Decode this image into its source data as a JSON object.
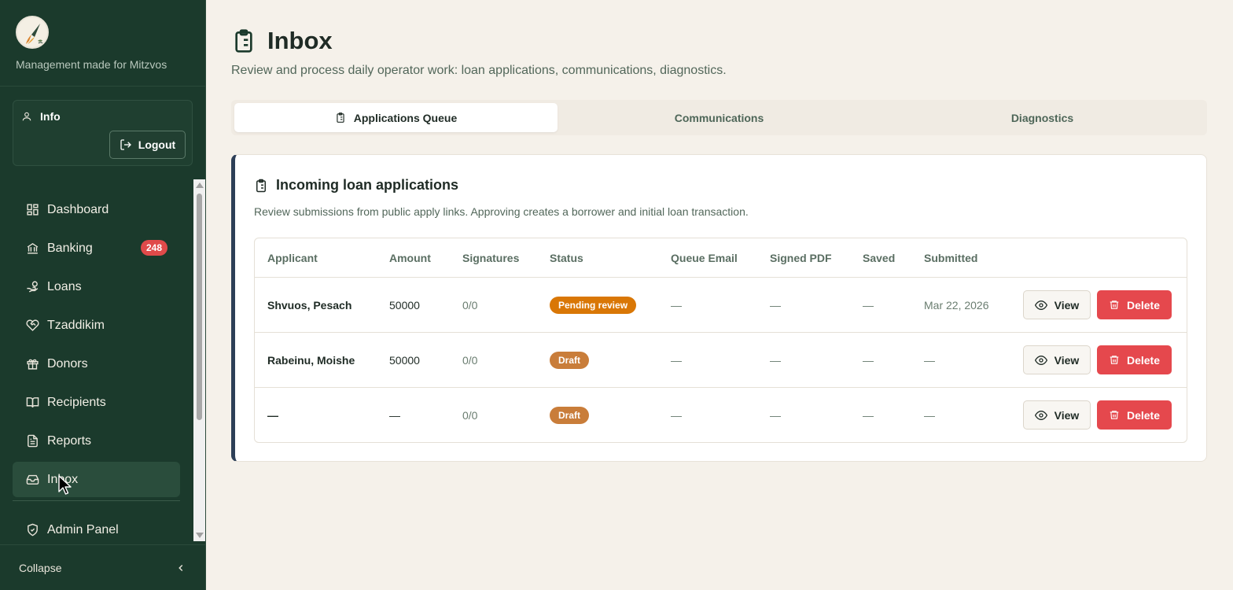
{
  "sidebar": {
    "tagline": "Management made for Mitzvos",
    "user_label": "Info",
    "logout_label": "Logout",
    "items": [
      {
        "label": "Dashboard",
        "icon": "dashboard-icon"
      },
      {
        "label": "Banking",
        "icon": "bank-icon",
        "badge": "248"
      },
      {
        "label": "Loans",
        "icon": "hand-coins-icon"
      },
      {
        "label": "Tzaddikim",
        "icon": "heart-handshake-icon"
      },
      {
        "label": "Donors",
        "icon": "gift-icon"
      },
      {
        "label": "Recipients",
        "icon": "book-open-icon"
      },
      {
        "label": "Reports",
        "icon": "file-text-icon"
      },
      {
        "label": "Inbox",
        "icon": "inbox-icon",
        "active": true
      },
      {
        "label": "Admin Panel",
        "icon": "shield-check-icon"
      }
    ],
    "collapse_label": "Collapse"
  },
  "header": {
    "title": "Inbox",
    "subtitle": "Review and process daily operator work: loan applications, communications, diagnostics."
  },
  "tabs": [
    {
      "label": "Applications Queue",
      "active": true
    },
    {
      "label": "Communications"
    },
    {
      "label": "Diagnostics"
    }
  ],
  "card": {
    "title": "Incoming loan applications",
    "subtitle": "Review submissions from public apply links. Approving creates a borrower and initial loan transaction."
  },
  "table": {
    "columns": [
      "Applicant",
      "Amount",
      "Signatures",
      "Status",
      "Queue Email",
      "Signed PDF",
      "Saved",
      "Submitted"
    ],
    "rows": [
      {
        "applicant": "Shvuos, Pesach",
        "amount": "50000",
        "signatures": "0/0",
        "status": "Pending review",
        "queue_email": "—",
        "signed_pdf": "—",
        "saved": "—",
        "submitted": "Mar 22, 2026"
      },
      {
        "applicant": "Rabeinu, Moishe",
        "amount": "50000",
        "signatures": "0/0",
        "status": "Draft",
        "queue_email": "—",
        "signed_pdf": "—",
        "saved": "—",
        "submitted": "—"
      },
      {
        "applicant": "—",
        "amount": "—",
        "signatures": "0/0",
        "status": "Draft",
        "queue_email": "—",
        "signed_pdf": "—",
        "saved": "—",
        "submitted": "—"
      }
    ],
    "view_label": "View",
    "delete_label": "Delete"
  },
  "colors": {
    "sidebar_bg": "#1b3a2c",
    "page_bg": "#f5f1ea",
    "pending": "#d97706",
    "draft": "#c97d3a",
    "delete": "#e5484d",
    "badge": "#e04a4a",
    "card_accent": "#2d3f57"
  }
}
